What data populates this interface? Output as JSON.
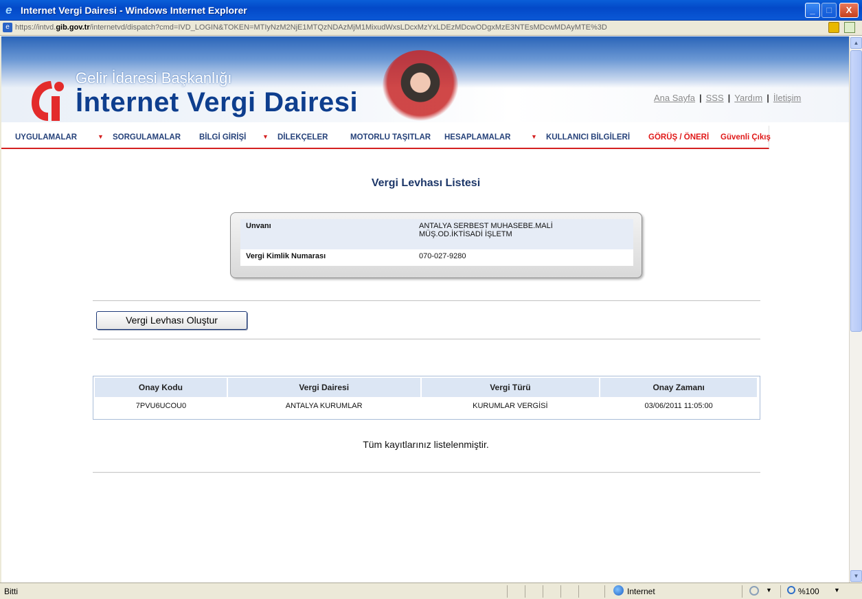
{
  "window": {
    "title": "Internet Vergi Dairesi - Windows Internet Explorer",
    "url_host": "https://intvd.",
    "url_domain": "gib.gov.tr",
    "url_rest": "/internetvd/dispatch?cmd=IVD_LOGIN&TOKEN=MTIyNzM2NjE1MTQzNDAzMjM1MixudWxsLDcxMzYxLDEzMDcwODgxMzE3NTEsMDcwMDAyMTE%3D",
    "buttons": {
      "minimize": "_",
      "maximize": "□",
      "close": "X"
    }
  },
  "header": {
    "brand_small": "Gelir İdaresi Başkanlığı",
    "brand_big": "İnternet Vergi Dairesi",
    "links": [
      "Ana Sayfa",
      "SSS",
      "Yardım",
      "İletişim"
    ],
    "link_sep": "|"
  },
  "menu": {
    "uygulamalar": "UYGULAMALAR",
    "sorgulamalar": "SORGULAMALAR",
    "bilgi_girisi": "BİLGİ GİRİŞİ",
    "dilekceler": "DİLEKÇELER",
    "motorlu_tasitlar": "MOTORLU TAŞITLAR",
    "hesaplamalar": "HESAPLAMALAR",
    "kullanici_bilgileri": "KULLANICI BİLGİLERİ",
    "gorus_oneri": "GÖRÜŞ / ÖNERİ",
    "guvenli_cikis": "Güvenli Çıkış",
    "caret": "▼"
  },
  "main": {
    "title": "Vergi Levhası Listesi",
    "info": {
      "unvan_label": "Unvanı",
      "unvan_line1": "ANTALYA SERBEST MUHASEBE.MALİ",
      "unvan_line2": "MÜŞ.OD.İKTİSADİ İŞLETM",
      "vkn_label": "Vergi Kimlik Numarası",
      "vkn_value": "070-027-9280"
    },
    "create_button": "Vergi Levhası Oluştur",
    "table": {
      "headers": [
        "Onay Kodu",
        "Vergi Dairesi",
        "Vergi Türü",
        "Onay Zamanı"
      ],
      "rows": [
        [
          "7PVU6UCOU0",
          "ANTALYA KURUMLAR",
          "KURUMLAR VERGİSİ",
          "03/06/2011 11:05:00"
        ]
      ]
    },
    "footnote": "Tüm kayıtlarınız listelenmiştir."
  },
  "status": {
    "text": "Bitti",
    "zone": "Internet",
    "zoom": "%100",
    "dropdown": "▼"
  },
  "colors": {
    "title_bar": "#0349c8",
    "menu_text": "#26427a",
    "menu_red": "#e01818",
    "heading": "#1c3668"
  }
}
